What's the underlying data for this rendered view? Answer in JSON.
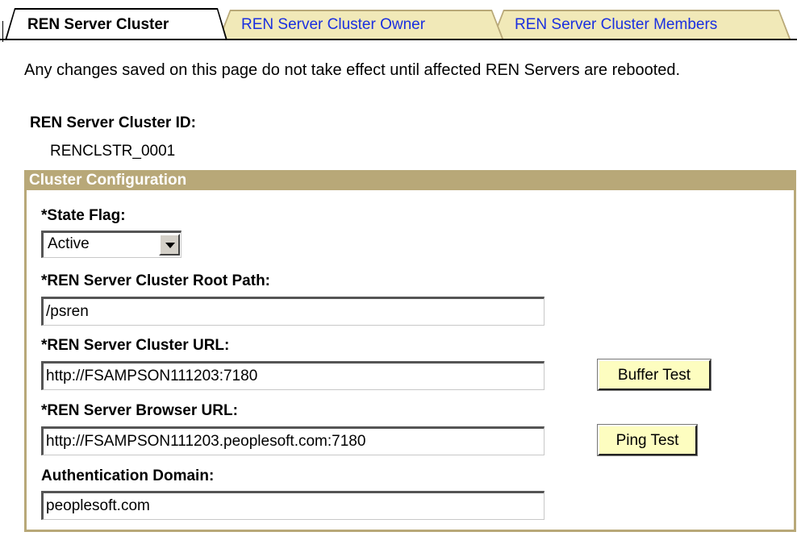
{
  "tabs": [
    {
      "label": "REN Server Cluster",
      "active": true
    },
    {
      "label": "REN Server Cluster Owner",
      "active": false
    },
    {
      "label": "REN Server Cluster Members",
      "active": false
    }
  ],
  "notice": "Any changes saved on this page do not take effect until affected REN Servers are rebooted.",
  "cluster_id": {
    "label": "REN Server Cluster ID:",
    "value": "RENCLSTR_0001"
  },
  "config": {
    "header": "Cluster Configuration",
    "state_flag": {
      "label": "*State Flag:",
      "value": "Active"
    },
    "root_path": {
      "label": "*REN Server Cluster Root Path:",
      "value": "/psren"
    },
    "cluster_url": {
      "label": "*REN Server Cluster URL:",
      "value": "http://FSAMPSON111203:7180"
    },
    "browser_url": {
      "label": "*REN Server Browser URL:",
      "value": "http://FSAMPSON111203.peoplesoft.com:7180"
    },
    "auth_domain": {
      "label": "Authentication Domain:",
      "value": "peoplesoft.com"
    },
    "buffer_test_label": "Buffer Test",
    "ping_test_label": "Ping Test"
  },
  "colors": {
    "tab_frame": "#b8a878",
    "tab_bg": "#f1e9b8",
    "link": "#1a2fe0",
    "button_bg": "#fdfdc0"
  }
}
